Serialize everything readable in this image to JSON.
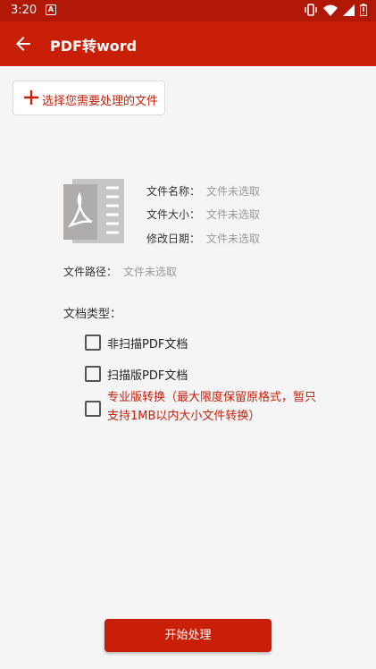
{
  "status": {
    "time": "3:20",
    "notification_letter": "A"
  },
  "appbar": {
    "title": "PDF转word"
  },
  "pick": {
    "label": "选择您需要处理的文件"
  },
  "info": [
    {
      "key": "文件名称：",
      "value": "文件未选取"
    },
    {
      "key": "文件大小：",
      "value": "文件未选取"
    },
    {
      "key": "修改日期：",
      "value": "文件未选取"
    }
  ],
  "path": {
    "key": "文件路径：",
    "value": "文件未选取"
  },
  "doc_type": {
    "label": "文档类型：",
    "options": [
      {
        "label": "非扫描PDF文档"
      },
      {
        "label": "扫描版PDF文档"
      },
      {
        "label": "专业版转换（最大限度保留原格式，暂只支持1MB以内大小文件转换）"
      }
    ]
  },
  "start": {
    "label": "开始处理"
  },
  "colors": {
    "primary": "#c91e08",
    "statusbar": "#b01705"
  },
  "icons": [
    "back-arrow-icon",
    "plus-icon",
    "pdf-file-icon",
    "vibrate-icon",
    "wifi-icon",
    "signal-icon",
    "battery-icon"
  ]
}
